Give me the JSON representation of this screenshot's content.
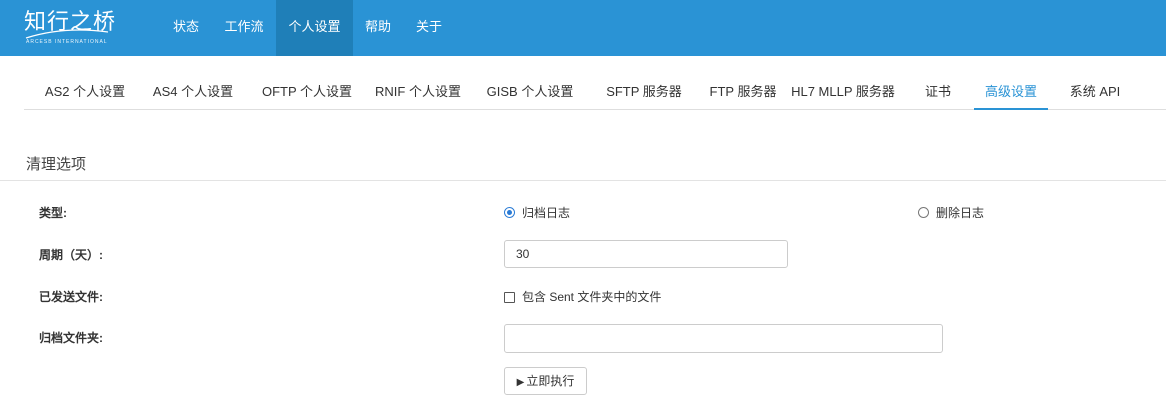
{
  "brand": {
    "name": "知行之桥",
    "subtitle": "ARCESB INTERNATIONAL"
  },
  "nav": {
    "items": [
      {
        "label": "状态"
      },
      {
        "label": "工作流"
      },
      {
        "label": "个人设置",
        "active": true
      },
      {
        "label": "帮助"
      },
      {
        "label": "关于"
      }
    ]
  },
  "tabs": [
    {
      "label": "AS2 个人设置"
    },
    {
      "label": "AS4 个人设置"
    },
    {
      "label": "OFTP 个人设置"
    },
    {
      "label": "RNIF 个人设置"
    },
    {
      "label": "GISB 个人设置"
    },
    {
      "label": "SFTP 服务器"
    },
    {
      "label": "FTP 服务器"
    },
    {
      "label": "HL7 MLLP 服务器"
    },
    {
      "label": "证书"
    },
    {
      "label": "高级设置",
      "active": true
    },
    {
      "label": "系统 API"
    }
  ],
  "section": {
    "title": "清理选项"
  },
  "form": {
    "type_label": "类型:",
    "type_options": [
      {
        "label": "归档日志",
        "checked": true
      },
      {
        "label": "删除日志",
        "checked": false
      }
    ],
    "period_label": "周期（天）:",
    "period_value": "30",
    "sent_files_label": "已发送文件:",
    "sent_files_checkbox_label": "包含 Sent 文件夹中的文件",
    "sent_files_checked": false,
    "archive_folder_label": "归档文件夹:",
    "archive_folder_value": "",
    "run_button": {
      "icon": "play-icon",
      "label": "立即执行"
    }
  },
  "colors": {
    "topbar": "#2a93d5",
    "topbar_active": "#1f7fb8",
    "accent": "#2a93d5"
  }
}
